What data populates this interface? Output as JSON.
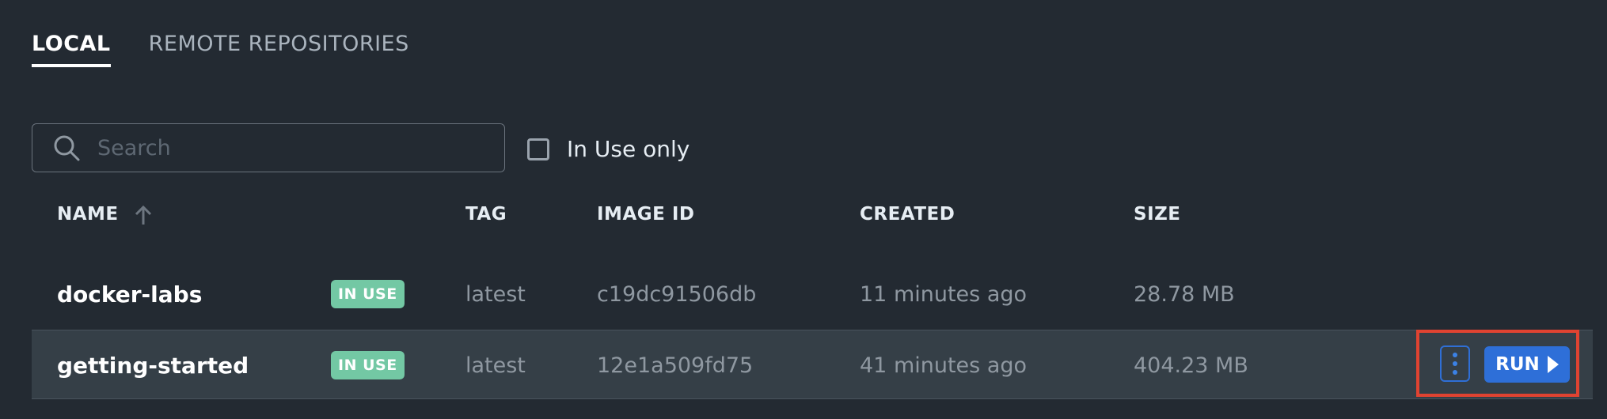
{
  "tabs": [
    {
      "label": "LOCAL",
      "active": true
    },
    {
      "label": "REMOTE REPOSITORIES",
      "active": false
    }
  ],
  "search": {
    "placeholder": "Search",
    "value": ""
  },
  "filter": {
    "label": "In Use only",
    "checked": false
  },
  "table": {
    "columns": [
      "NAME",
      "TAG",
      "IMAGE ID",
      "CREATED",
      "SIZE"
    ],
    "sort": {
      "column": "NAME",
      "direction": "ascending"
    },
    "rows": [
      {
        "name": "docker-labs",
        "badge": "IN USE",
        "tag": "latest",
        "image_id": "c19dc91506db",
        "created": "11 minutes ago",
        "size": "28.78 MB"
      },
      {
        "name": "getting-started",
        "badge": "IN USE",
        "tag": "latest",
        "image_id": "12e1a509fd75",
        "created": "41 minutes ago",
        "size": "404.23 MB"
      }
    ]
  },
  "row_actions": {
    "run_label": "RUN",
    "more_icon": "kebab-menu-icon",
    "run_icon": "play-icon"
  },
  "colors": {
    "background": "#232a32",
    "accent": "#2e6fd8",
    "badge": "#73c8a4",
    "highlight": "#e04331"
  }
}
